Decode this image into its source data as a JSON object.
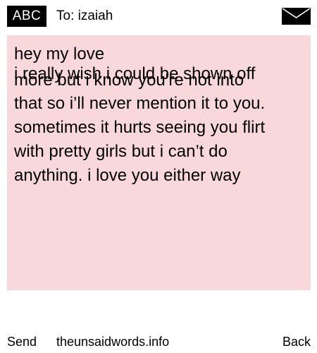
{
  "header": {
    "badge_label": "ABC",
    "recipient_line": "To: izaiah",
    "envelope_icon": "envelope-icon"
  },
  "message": {
    "background_color": "#f9d8dc",
    "greeting": "hey my love",
    "line_1": "i really wish i could be shown off",
    "line_2": "more but i know you're not into",
    "line_3": "that so i’ll never mention it to you.",
    "line_4": "sometimes it hurts seeing you flirt",
    "line_5": "with pretty girls but i can’t do",
    "line_6": "anything. i love you either way"
  },
  "footer": {
    "send_label": "Send",
    "site_label": "theunsaidwords.info",
    "back_label": "Back"
  }
}
